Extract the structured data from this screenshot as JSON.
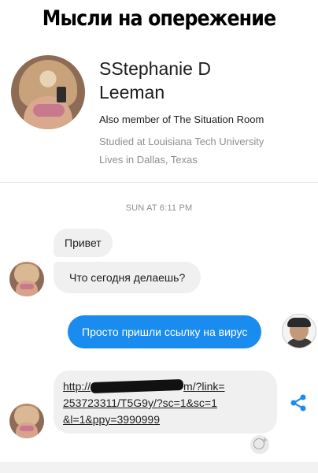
{
  "meme": {
    "title": "Мысли на опережение"
  },
  "profile": {
    "name_line1": "SStephanie D",
    "name_line2": "Leeman",
    "mutual": "Also member of The Situation Room",
    "education": "Studied at Louisiana Tech University",
    "location": "Lives in Dallas, Texas"
  },
  "chat": {
    "timestamp": "SUN AT 6:11 PM",
    "incoming_1": "Привет",
    "incoming_2": "Что сегодня делаешь?",
    "outgoing_1": "Просто пришли ссылку на вирус",
    "link": {
      "line1_prefix": "http://",
      "line1_suffix": "m/?link=",
      "line2": "253723311/T5G9y/?sc=1&sc=1",
      "line3": "&l=1&ppy=3990999"
    }
  },
  "icons": {
    "share": "share-icon",
    "reaction": "add-reaction-icon"
  },
  "colors": {
    "outgoing_bubble": "#1a8cf0",
    "incoming_bubble": "#f0f0f0",
    "share_icon": "#1a8cf0"
  }
}
